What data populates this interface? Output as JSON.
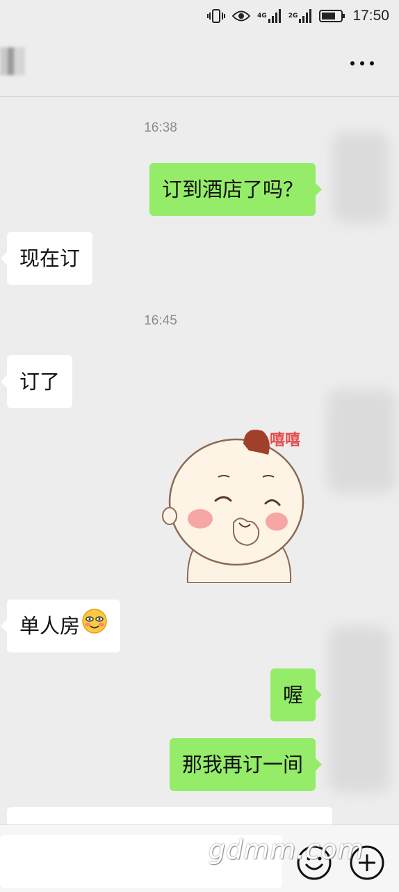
{
  "status_bar": {
    "network_1": "4G",
    "network_2": "2G",
    "time": "17:50"
  },
  "nav": {
    "chat_title": "",
    "more_icon": "more-dots-icon"
  },
  "messages": [
    {
      "kind": "time",
      "text": "16:38"
    },
    {
      "kind": "sent",
      "text": "订到酒店了吗？"
    },
    {
      "kind": "received",
      "text": "现在订"
    },
    {
      "kind": "time",
      "text": "16:45"
    },
    {
      "kind": "received",
      "text": "订了"
    },
    {
      "kind": "sticker",
      "text": "嘻嘻",
      "icon": "baby-sticker"
    },
    {
      "kind": "received",
      "text": "单人房",
      "emoji": "smiling-face-emoji"
    },
    {
      "kind": "sent",
      "text": "喔"
    },
    {
      "kind": "sent",
      "text": "那我再订一间"
    }
  ],
  "input_bar": {
    "value": "",
    "emoji_icon": "emoji-icon",
    "plus_icon": "plus-icon"
  },
  "watermark": "gdmm.com",
  "colors": {
    "background": "#ededed",
    "sent_bubble": "#95ec69",
    "received_bubble": "#ffffff"
  }
}
